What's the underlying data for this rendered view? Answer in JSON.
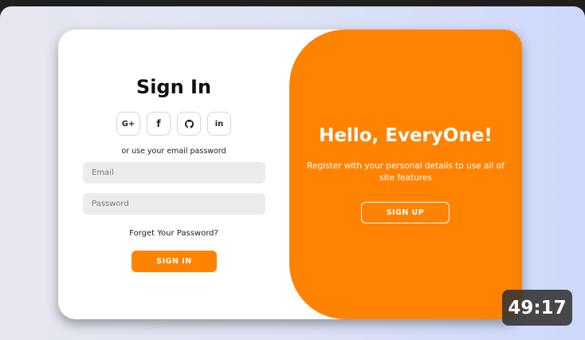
{
  "signin": {
    "title": "Sign In",
    "social": [
      {
        "label": "G+",
        "icon": "google-plus-icon"
      },
      {
        "label": "f",
        "icon": "facebook-icon"
      },
      {
        "label": "",
        "icon": "github-icon"
      },
      {
        "label": "in",
        "icon": "linkedin-icon"
      }
    ],
    "alt_text": "or use your email password",
    "email_placeholder": "Email",
    "password_placeholder": "Password",
    "forgot": "Forget Your Password?",
    "button": "SIGN IN"
  },
  "signup": {
    "title": "Hello, EveryOne!",
    "text": "Register with your personal details to use all of site features",
    "button": "SIGN UP"
  },
  "video": {
    "duration": "49:17"
  },
  "colors": {
    "accent": "#ff8200",
    "card": "#ffffff",
    "input_bg": "#ececec"
  }
}
